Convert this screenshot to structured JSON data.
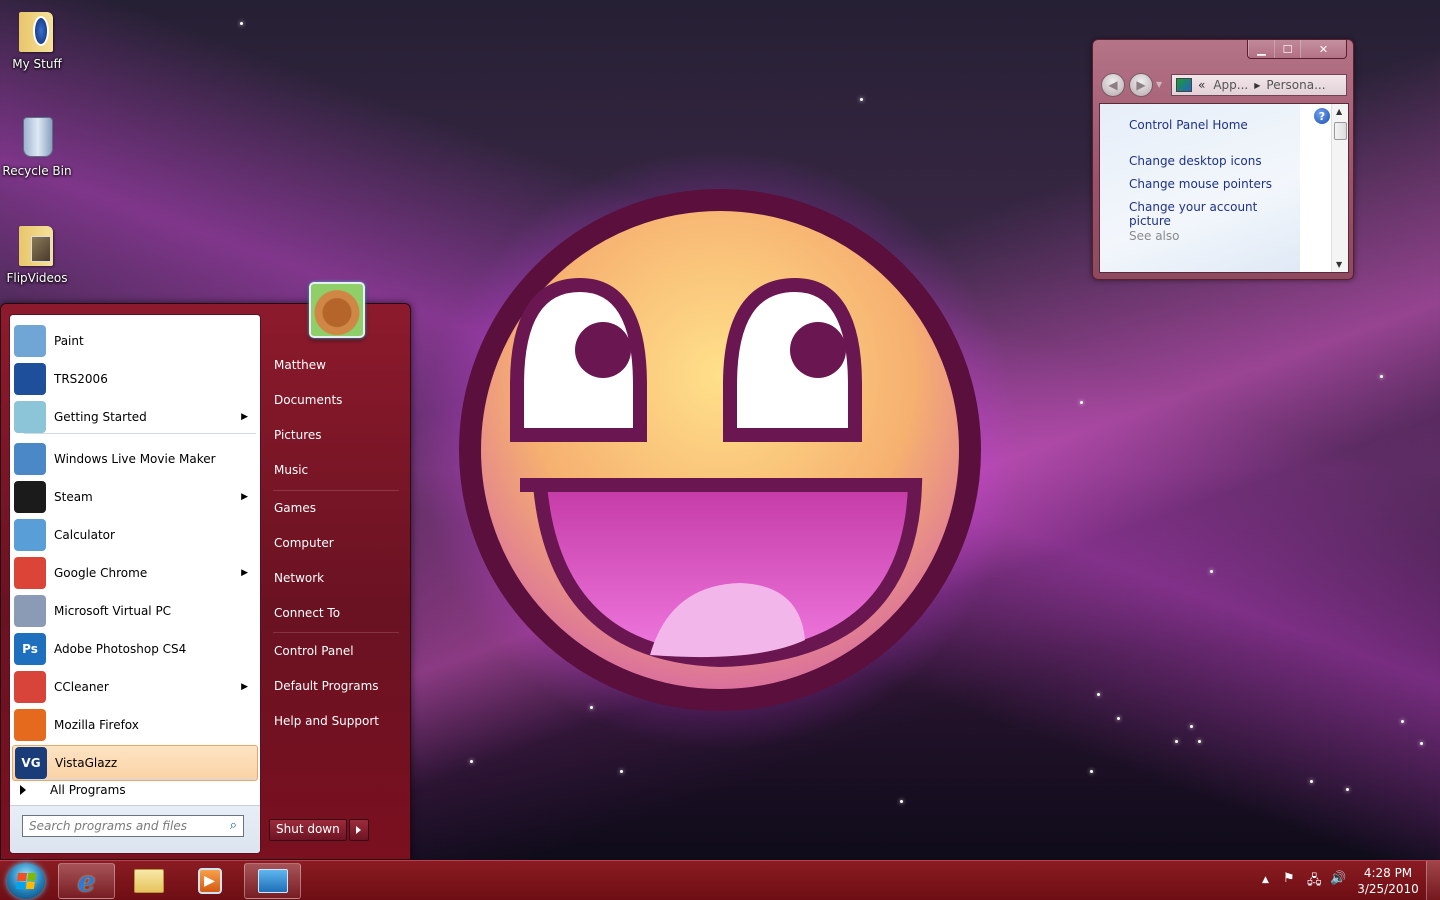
{
  "desktop": {
    "icons": [
      {
        "label": "My Stuff",
        "icon": "folder-icon"
      },
      {
        "label": "Recycle Bin",
        "icon": "recycle-bin-icon"
      },
      {
        "label": "FlipVideos",
        "icon": "folder-icon"
      }
    ],
    "wallpaper": "awesome-smiley-face-galaxy"
  },
  "start_menu": {
    "pinned": [
      {
        "label": "Paint",
        "icon": "paint-icon",
        "color": "#6fa6d6"
      },
      {
        "label": "TRS2006",
        "icon": "trs2006-icon",
        "color": "#1d4f9a"
      },
      {
        "label": "Getting Started",
        "icon": "getting-started-icon",
        "color": "#8cc4d8",
        "submenu": true
      }
    ],
    "recent": [
      {
        "label": "Windows Live Movie Maker",
        "icon": "movie-maker-icon",
        "color": "#4a88c8"
      },
      {
        "label": "Steam",
        "icon": "steam-icon",
        "color": "#1b1b1b",
        "submenu": true
      },
      {
        "label": "Calculator",
        "icon": "calculator-icon",
        "color": "#5a9ed8"
      },
      {
        "label": "Google Chrome",
        "icon": "chrome-icon",
        "color": "#db4437",
        "submenu": true
      },
      {
        "label": "Microsoft Virtual PC",
        "icon": "virtual-pc-icon",
        "color": "#8c9bb5"
      },
      {
        "label": "Adobe Photoshop CS4",
        "icon": "photoshop-icon",
        "color": "#1f6fbf",
        "glyph": "Ps"
      },
      {
        "label": "CCleaner",
        "icon": "ccleaner-icon",
        "color": "#d8443a",
        "submenu": true
      },
      {
        "label": "Mozilla Firefox",
        "icon": "firefox-icon",
        "color": "#e66a1e"
      },
      {
        "label": "VistaGlazz",
        "icon": "vistaglazz-icon",
        "color": "#1a3d7a",
        "glyph": "VG",
        "selected": true
      }
    ],
    "all_programs": "All Programs",
    "search_placeholder": "Search programs and files",
    "right_links": [
      {
        "label": "Matthew"
      },
      {
        "label": "Documents"
      },
      {
        "label": "Pictures"
      },
      {
        "label": "Music"
      },
      {
        "label": "Games"
      },
      {
        "label": "Computer"
      },
      {
        "label": "Network"
      },
      {
        "label": "Connect To"
      },
      {
        "label": "Control Panel"
      },
      {
        "label": "Default Programs"
      },
      {
        "label": "Help and Support"
      }
    ],
    "shutdown_label": "Shut down"
  },
  "control_panel_window": {
    "breadcrumb": [
      "«",
      "App...",
      "Persona..."
    ],
    "nav_links": [
      "Control Panel Home",
      "Change desktop icons",
      "Change mouse pointers",
      "Change your account picture"
    ],
    "see_also": "See also",
    "controls": {
      "minimize": "▁",
      "maximize": "☐",
      "close": "✕"
    }
  },
  "taskbar": {
    "pinned": [
      {
        "name": "internet-explorer",
        "icon": "ie-icon",
        "active": true
      },
      {
        "name": "windows-explorer",
        "icon": "explorer-icon",
        "active": false
      },
      {
        "name": "media-player",
        "icon": "media-player-icon",
        "active": false
      },
      {
        "name": "control-panel",
        "icon": "control-panel-icon",
        "active": true
      }
    ],
    "tray": {
      "show_hidden": "▲",
      "flag": "⚑",
      "network": "🖧",
      "volume": "🔊"
    },
    "time": "4:28 PM",
    "date": "3/25/2010"
  }
}
